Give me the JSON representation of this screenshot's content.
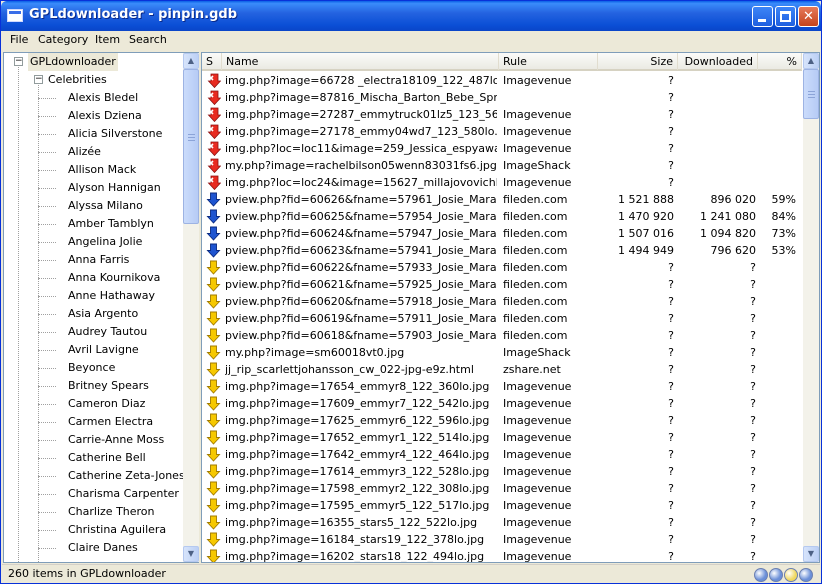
{
  "window": {
    "title": "GPLdownloader - pinpin.gdb"
  },
  "menu": {
    "items": [
      "File",
      "Category",
      "Item",
      "Search"
    ]
  },
  "tree": {
    "root": "GPLdownloader",
    "category": "Celebrities",
    "items": [
      "Alexis Bledel",
      "Alexis Dziena",
      "Alicia Silverstone",
      "Alizée",
      "Allison Mack",
      "Alyson Hannigan",
      "Alyssa Milano",
      "Amber Tamblyn",
      "Angelina Jolie",
      "Anna Farris",
      "Anna Kournikova",
      "Anne Hathaway",
      "Asia Argento",
      "Audrey Tautou",
      "Avril Lavigne",
      "Beyonce",
      "Britney Spears",
      "Cameron Diaz",
      "Carmen Electra",
      "Carrie-Anne Moss",
      "Catherine Bell",
      "Catherine Zeta-Jones",
      "Charisma Carpenter",
      "Charlize Theron",
      "Christina Aguilera",
      "Claire Danes"
    ]
  },
  "table": {
    "columns": {
      "s": "S",
      "name": "Name",
      "rule": "Rule",
      "size": "Size",
      "downloaded": "Downloaded",
      "pct": "%"
    },
    "rows": [
      {
        "status": "error",
        "name": "img.php?image=66728 _electra18109_122_487lo.jpg",
        "rule": "Imagevenue",
        "size": "?",
        "downloaded": "",
        "pct": ""
      },
      {
        "status": "error",
        "name": "img.php?image=87816_Mischa_Barton_Bebe_Spring...",
        "rule": "",
        "size": "?",
        "downloaded": "",
        "pct": ""
      },
      {
        "status": "error",
        "name": "img.php?image=27287_emmytruck01lz5_123_563lo....",
        "rule": "Imagevenue",
        "size": "?",
        "downloaded": "",
        "pct": ""
      },
      {
        "status": "error",
        "name": "img.php?image=27178_emmy04wd7_123_580lo.jpg",
        "rule": "Imagevenue",
        "size": "?",
        "downloaded": "",
        "pct": ""
      },
      {
        "status": "error",
        "name": "img.php?loc=loc11&image=259_Jessica_espyawar...",
        "rule": "Imagevenue",
        "size": "?",
        "downloaded": "",
        "pct": ""
      },
      {
        "status": "error",
        "name": "my.php?image=rachelbilson05wenn83031fs6.jpg",
        "rule": "ImageShack",
        "size": "?",
        "downloaded": "",
        "pct": ""
      },
      {
        "status": "error",
        "name": "img.php?loc=loc24&image=15627_millajovovichlind9...",
        "rule": "Imagevenue",
        "size": "?",
        "downloaded": "",
        "pct": ""
      },
      {
        "status": "active",
        "name": "pview.php?fid=60626&fname=57961_Josie_Maran1...",
        "rule": "fileden.com",
        "size": "1 521 888",
        "downloaded": "896 020",
        "pct": "59%"
      },
      {
        "status": "active",
        "name": "pview.php?fid=60625&fname=57954_Josie_Maran1...",
        "rule": "fileden.com",
        "size": "1 470 920",
        "downloaded": "1 241 080",
        "pct": "84%"
      },
      {
        "status": "active",
        "name": "pview.php?fid=60624&fname=57947_Josie_Maran1...",
        "rule": "fileden.com",
        "size": "1 507 016",
        "downloaded": "1 094 820",
        "pct": "73%"
      },
      {
        "status": "active",
        "name": "pview.php?fid=60623&fname=57941_Josie_Maran1...",
        "rule": "fileden.com",
        "size": "1 494 949",
        "downloaded": "796 620",
        "pct": "53%"
      },
      {
        "status": "queued",
        "name": "pview.php?fid=60622&fname=57933_Josie_Maran1...",
        "rule": "fileden.com",
        "size": "?",
        "downloaded": "?",
        "pct": ""
      },
      {
        "status": "queued",
        "name": "pview.php?fid=60621&fname=57925_Josie_Maran1...",
        "rule": "fileden.com",
        "size": "?",
        "downloaded": "?",
        "pct": ""
      },
      {
        "status": "queued",
        "name": "pview.php?fid=60620&fname=57918_Josie_Maran9...",
        "rule": "fileden.com",
        "size": "?",
        "downloaded": "?",
        "pct": ""
      },
      {
        "status": "queued",
        "name": "pview.php?fid=60619&fname=57911_Josie_Maran1...",
        "rule": "fileden.com",
        "size": "?",
        "downloaded": "?",
        "pct": ""
      },
      {
        "status": "queued",
        "name": "pview.php?fid=60618&fname=57903_Josie_Maran7...",
        "rule": "fileden.com",
        "size": "?",
        "downloaded": "?",
        "pct": ""
      },
      {
        "status": "queued",
        "name": "my.php?image=sm60018vt0.jpg",
        "rule": "ImageShack",
        "size": "?",
        "downloaded": "?",
        "pct": ""
      },
      {
        "status": "queued",
        "name": "jj_rip_scarlettjohansson_cw_022-jpg-e9z.html",
        "rule": "zshare.net",
        "size": "?",
        "downloaded": "?",
        "pct": ""
      },
      {
        "status": "queued",
        "name": "img.php?image=17654_emmyr8_122_360lo.jpg",
        "rule": "Imagevenue",
        "size": "?",
        "downloaded": "?",
        "pct": ""
      },
      {
        "status": "queued",
        "name": "img.php?image=17609_emmyr7_122_542lo.jpg",
        "rule": "Imagevenue",
        "size": "?",
        "downloaded": "?",
        "pct": ""
      },
      {
        "status": "queued",
        "name": "img.php?image=17625_emmyr6_122_596lo.jpg",
        "rule": "Imagevenue",
        "size": "?",
        "downloaded": "?",
        "pct": ""
      },
      {
        "status": "queued",
        "name": "img.php?image=17652_emmyr1_122_514lo.jpg",
        "rule": "Imagevenue",
        "size": "?",
        "downloaded": "?",
        "pct": ""
      },
      {
        "status": "queued",
        "name": "img.php?image=17642_emmyr4_122_464lo.jpg",
        "rule": "Imagevenue",
        "size": "?",
        "downloaded": "?",
        "pct": ""
      },
      {
        "status": "queued",
        "name": "img.php?image=17614_emmyr3_122_528lo.jpg",
        "rule": "Imagevenue",
        "size": "?",
        "downloaded": "?",
        "pct": ""
      },
      {
        "status": "queued",
        "name": "img.php?image=17598_emmyr2_122_308lo.jpg",
        "rule": "Imagevenue",
        "size": "?",
        "downloaded": "?",
        "pct": ""
      },
      {
        "status": "queued",
        "name": "img.php?image=17595_emmyr5_122_517lo.jpg",
        "rule": "Imagevenue",
        "size": "?",
        "downloaded": "?",
        "pct": ""
      },
      {
        "status": "queued",
        "name": "img.php?image=16355_stars5_122_522lo.jpg",
        "rule": "Imagevenue",
        "size": "?",
        "downloaded": "?",
        "pct": ""
      },
      {
        "status": "queued",
        "name": "img.php?image=16184_stars19_122_378lo.jpg",
        "rule": "Imagevenue",
        "size": "?",
        "downloaded": "?",
        "pct": ""
      },
      {
        "status": "queued",
        "name": "img.php?image=16202_stars18_122_494lo.jpg",
        "rule": "Imagevenue",
        "size": "?",
        "downloaded": "?",
        "pct": ""
      }
    ]
  },
  "status": {
    "text": "260 items in GPLdownloader",
    "indicator_colors": [
      "#6a8fd8",
      "#6a8fd8",
      "#f0d860",
      "#6a8fd8"
    ]
  },
  "colors": {
    "title_bar": "#0a4fd6",
    "selection": "#ece9d8",
    "error_icon": "#e02020",
    "active_icon": "#1a4fc8",
    "queued_icon": "#f0c000"
  }
}
